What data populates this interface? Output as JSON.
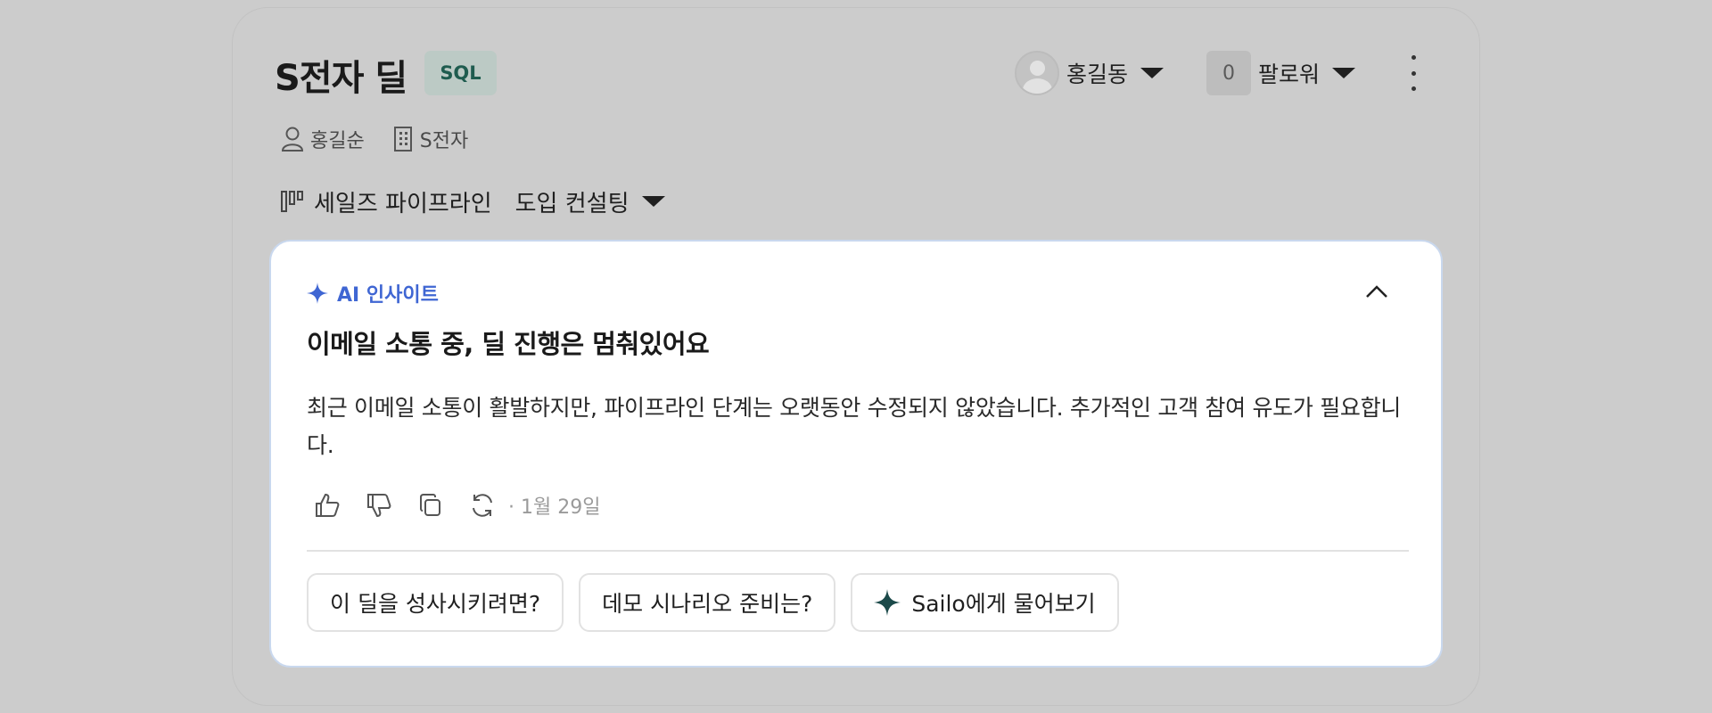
{
  "header": {
    "deal_title": "S전자 딜",
    "stage_badge": "SQL",
    "owner": {
      "name": "홍길동",
      "icon": "avatar-icon"
    },
    "followers": {
      "count": "0",
      "label": "팔로워"
    },
    "more_icon": "kebab-menu-icon"
  },
  "meta": {
    "contact": {
      "icon": "person-icon",
      "label": "홍길순"
    },
    "company": {
      "icon": "building-icon",
      "label": "S전자"
    }
  },
  "pipeline": {
    "icon": "kanban-icon",
    "name": "세일즈 파이프라인",
    "stage": "도입 컨설팅"
  },
  "insight_card": {
    "label": "AI 인사이트",
    "title": "이메일 소통 중, 딜 진행은 멈춰있어요",
    "body": "최근 이메일 소통이 활발하지만, 파이프라인 단계는 오랫동안 수정되지 않았습니다. 추가적인 고객 참여 유도가 필요합니다.",
    "date": "· 1월 29일",
    "colors": {
      "accent": "#3f66d3",
      "sparkle_dark": "#1c4a4a",
      "card_border": "#c9d8ee"
    },
    "suggestions": [
      {
        "label": "이 딜을 성사시키려면?"
      },
      {
        "label": "데모 시나리오 준비는?"
      },
      {
        "label": "Sailo에게 물어보기",
        "icon": "sparkle-icon"
      }
    ]
  }
}
